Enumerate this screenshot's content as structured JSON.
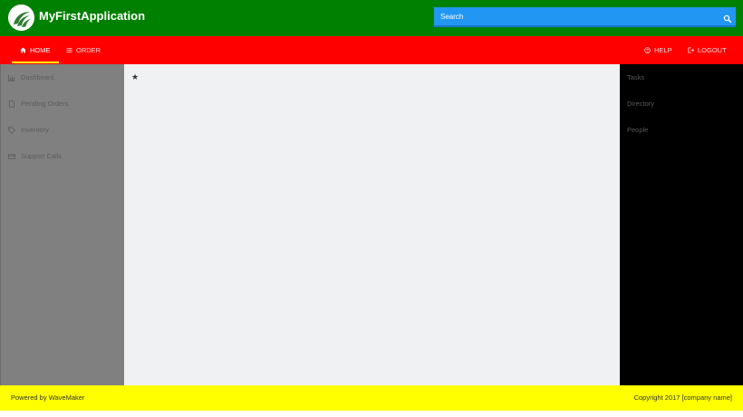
{
  "colors": {
    "header_bg": "#008000",
    "nav_bg": "#ff0000",
    "nav_active_underline": "#ffff00",
    "sidebar_bg": "#808080",
    "main_bg": "#eff1f3",
    "right_panel_bg": "#000000",
    "footer_bg": "#ffff00",
    "search_bg": "#2196f3"
  },
  "header": {
    "app_title": "MyFirstApplication",
    "logo_icon": "wavemaker-logo-icon",
    "search": {
      "placeholder": "Search",
      "icon": "search-icon"
    }
  },
  "nav": {
    "left": [
      {
        "label": "HOME",
        "icon": "home-icon",
        "active": true
      },
      {
        "label": "ORDER",
        "icon": "list-icon",
        "active": false
      }
    ],
    "right": [
      {
        "label": "HELP",
        "icon": "help-circle-icon"
      },
      {
        "label": "LOGOUT",
        "icon": "logout-icon"
      }
    ]
  },
  "sidebar": {
    "items": [
      {
        "label": "Dashboard",
        "icon": "bar-chart-icon"
      },
      {
        "label": "Pending Orders",
        "icon": "document-icon"
      },
      {
        "label": "Inventory",
        "icon": "tag-icon"
      },
      {
        "label": "Support Calls",
        "icon": "card-icon"
      }
    ]
  },
  "main": {
    "marker": "★"
  },
  "right_panel": {
    "items": [
      {
        "label": "Tasks"
      },
      {
        "label": "Directory"
      },
      {
        "label": "People"
      }
    ]
  },
  "footer": {
    "left": "Powered by WaveMaker",
    "right": "Copyright 2017 [company name]"
  }
}
